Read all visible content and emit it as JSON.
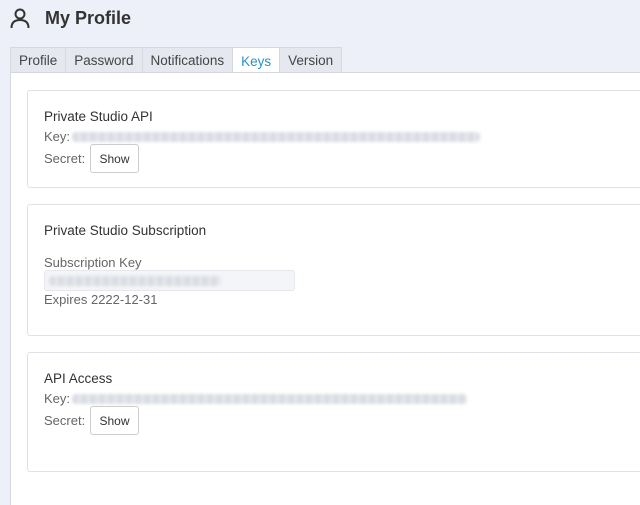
{
  "header": {
    "title": "My Profile",
    "icon": "user-icon"
  },
  "tabs": [
    {
      "label": "Profile"
    },
    {
      "label": "Password"
    },
    {
      "label": "Notifications"
    },
    {
      "label": "Keys",
      "active": true
    },
    {
      "label": "Version"
    }
  ],
  "cards": {
    "studio_api": {
      "title": "Private Studio API",
      "key_label": "Key:",
      "secret_label": "Secret:",
      "show_label": "Show"
    },
    "subscription": {
      "title": "Private Studio Subscription",
      "key_label": "Subscription Key",
      "expires": "Expires 2222-12-31"
    },
    "api_access": {
      "title": "API Access",
      "key_label": "Key:",
      "secret_label": "Secret:",
      "show_label": "Show"
    }
  },
  "colors": {
    "accent": "#2b90c7",
    "background": "#eef0f9"
  }
}
